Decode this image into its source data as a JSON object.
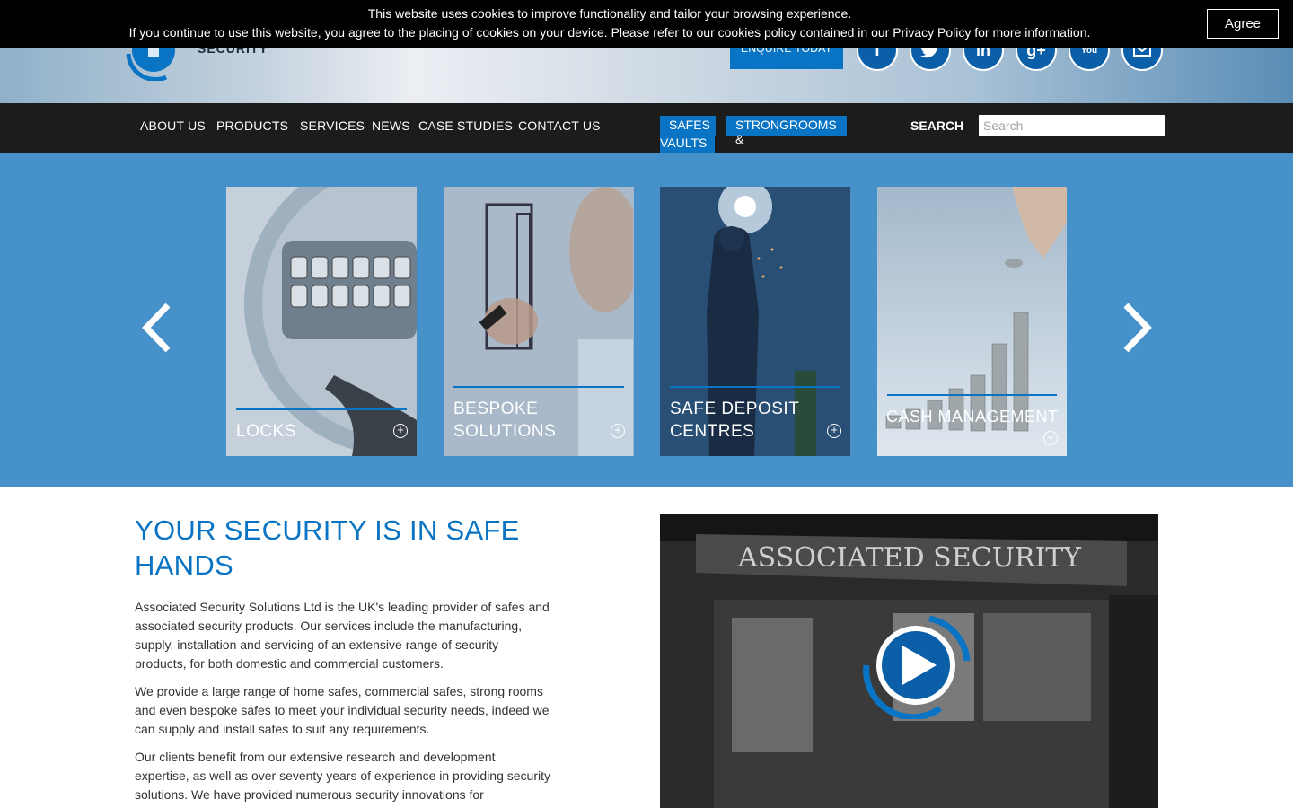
{
  "cookie_bar": {
    "line1": "This website uses cookies to improve functionality and tailor your browsing experience.",
    "line2": "If you continue to use this website, you agree to the placing of cookies on your device. Please refer to our cookies policy contained in our Privacy Policy for more information.",
    "agree_label": "Agree"
  },
  "header": {
    "logo_text": "SECURITY",
    "enquire_label": "ENQUIRE TODAY",
    "social_icons": [
      "facebook-icon",
      "twitter-icon",
      "linkedin-icon",
      "google-plus-icon",
      "youtube-icon",
      "email-icon"
    ],
    "social_glyphs": {
      "fb": "f",
      "li": "in",
      "gp": "g+",
      "yt": "You"
    }
  },
  "nav": {
    "items": [
      "ABOUT US",
      "PRODUCTS",
      "SERVICES",
      "NEWS",
      "CASE STUDIES",
      "CONTACT US"
    ],
    "highlight": [
      "SAFES",
      "STRONGROOMS &",
      "VAULTS"
    ],
    "search_label": "SEARCH",
    "search_placeholder": "Search"
  },
  "carousel": {
    "cards": [
      {
        "title": "LOCKS"
      },
      {
        "title_lines": [
          "BESPOKE",
          "SOLUTIONS"
        ]
      },
      {
        "title_lines": [
          "SAFE DEPOSIT",
          "CENTRES"
        ]
      },
      {
        "title": "CASH MANAGEMENT"
      }
    ]
  },
  "content": {
    "heading_lines": [
      "YOUR SECURITY IS IN SAFE",
      "HANDS"
    ],
    "paragraphs": [
      "Associated Security Solutions Ltd is the UK's leading provider of safes and associated security products. Our services include the manufacturing, supply, installation and servicing of an extensive range of security products, for both domestic and commercial customers.",
      "We provide a large range of home safes, commercial safes, strong rooms and even bespoke safes to meet your individual security needs, indeed we can supply and install safes to suit any requirements.",
      "Our clients benefit from our extensive research and development expertise, as well as over seventy years of experience in providing security solutions. We have provided numerous security innovations for"
    ],
    "video_sign": "ASSOCIATED SECURITY"
  },
  "colors": {
    "brand_blue": "#0a74c4",
    "carousel_bg": "#4791cb",
    "nav_bg": "#1c1c1c"
  }
}
